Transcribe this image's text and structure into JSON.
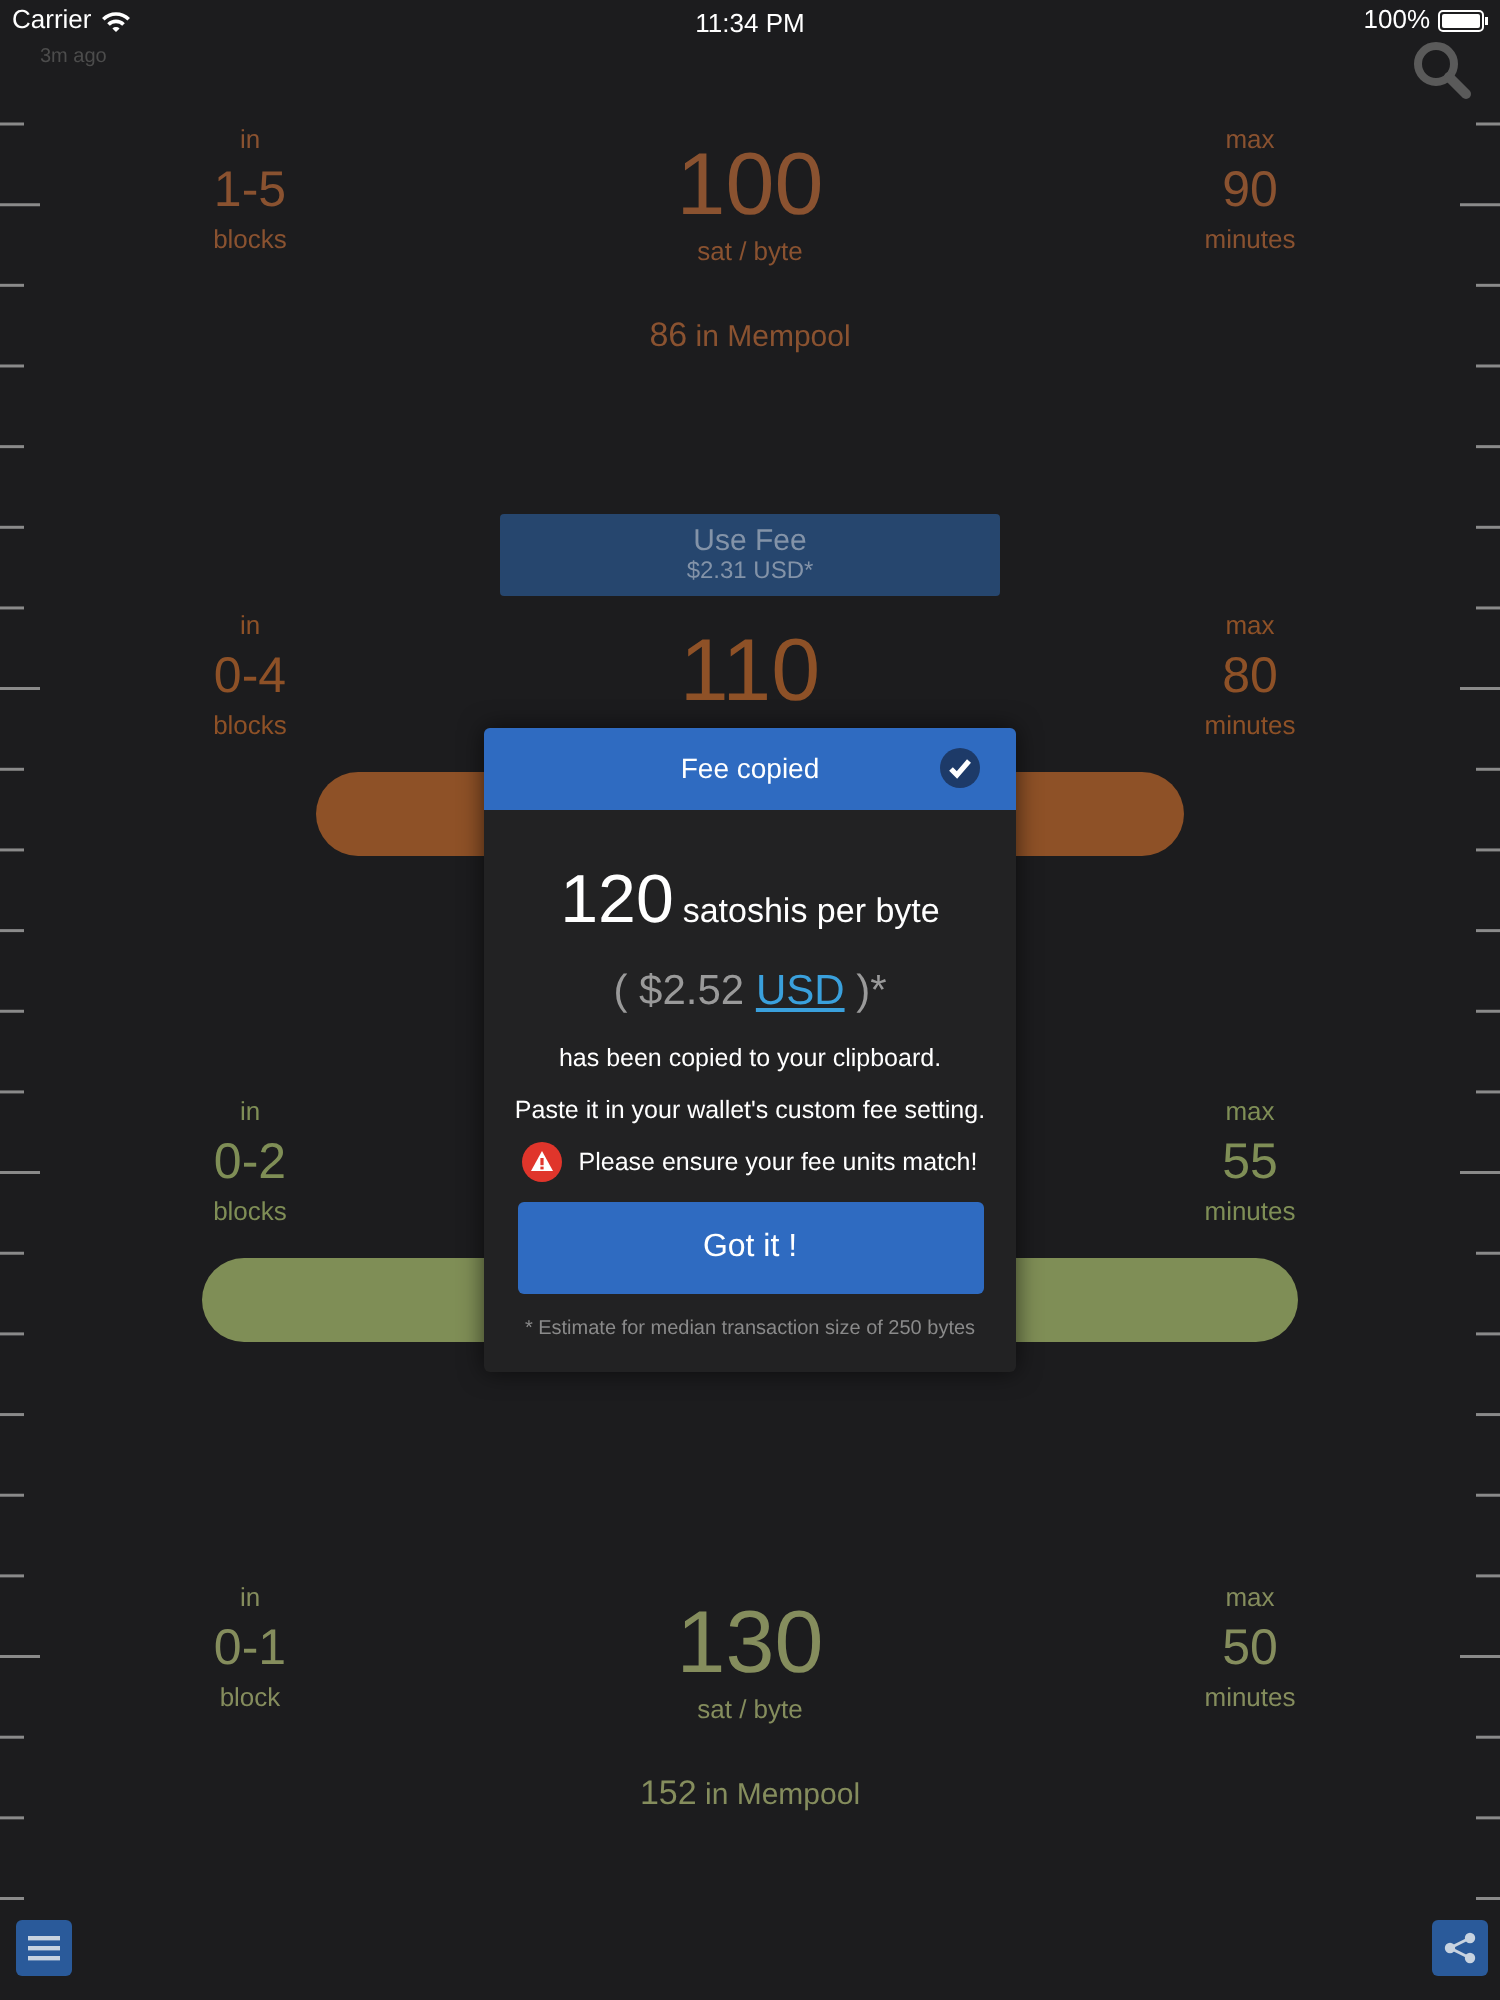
{
  "status_bar": {
    "carrier": "Carrier",
    "time": "11:34 PM",
    "battery": "100%"
  },
  "updated": "3m ago",
  "tiers": [
    {
      "kind": "plain",
      "in_label": "in",
      "range": "1-5",
      "range_unit": "blocks",
      "fee": "100",
      "fee_unit": "sat / byte",
      "mempool_count": "86",
      "mempool_label": "in Mempool",
      "max_label": "max",
      "minutes": "90",
      "minutes_unit": "minutes",
      "color": "#8a5230",
      "use_fee": {
        "label": "Use Fee",
        "price": "$2.31 USD*"
      }
    },
    {
      "in_label": "in",
      "range": "0-4",
      "range_unit": "blocks",
      "fee": "110",
      "max_label": "max",
      "minutes": "80",
      "minutes_unit": "minutes",
      "color": "#8e5127",
      "kind": "shortbar"
    },
    {
      "in_label": "in",
      "range": "0-2",
      "range_unit": "blocks",
      "max_label": "max",
      "minutes": "55",
      "minutes_unit": "minutes",
      "color": "#7f8e56",
      "kind": "longbar"
    },
    {
      "kind": "plain",
      "in_label": "in",
      "range": "0-1",
      "range_unit": "block",
      "fee": "130",
      "fee_unit": "sat / byte",
      "mempool_count": "152",
      "mempool_label": "in Mempool",
      "max_label": "max",
      "minutes": "50",
      "minutes_unit": "minutes",
      "color": "#858d5d"
    }
  ],
  "dialog": {
    "title": "Fee copied",
    "confirmed": true,
    "fee": "120",
    "fee_unit": "satoshis per byte",
    "price_before": "( $2.52",
    "currency": "USD",
    "price_after": ")*",
    "messages": [
      "has been copied to your clipboard.",
      "Paste it in your wallet's custom fee setting."
    ],
    "warning": "Please ensure your fee units match!",
    "button": "Got it !",
    "footnote": "* Estimate for median transaction size of 250 bytes"
  }
}
